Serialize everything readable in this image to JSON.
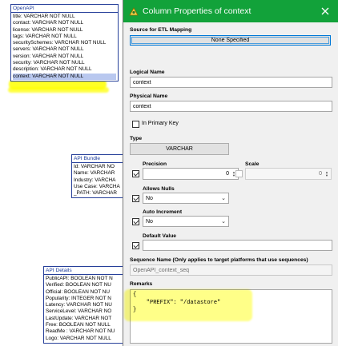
{
  "diagram": {
    "openapi": {
      "title": "OpenAPI",
      "rows": [
        "title: VARCHAR   NOT NULL",
        "contact: VARCHAR   NOT NULL",
        "license: VARCHAR   NOT NULL",
        "tags: VARCHAR   NOT NULL",
        "securitySchemes: VARCHAR   NOT NULL",
        "servers: VARCHAR   NOT NULL",
        "version: VARCHAR   NOT NULL",
        "security: VARCHAR   NOT NULL",
        "description: VARCHAR   NOT NULL",
        "context: VARCHAR   NOT NULL"
      ]
    },
    "api_bundle": {
      "title": "API Bundle",
      "rows": [
        "Id: VARCHAR   NO",
        "Name: VARCHAR",
        "Industry: VARCHA",
        "Use Case: VARCHA",
        "_PATH: VARCHAR"
      ]
    },
    "api_details": {
      "title": "API Details",
      "rows": [
        "PublicAPI: BOOLEAN   NOT N",
        "Verified: BOOLEAN   NOT NU",
        "Official: BOOLEAN   NOT NU",
        "Popularity: INTEGER   NOT N",
        "Latency: VARCHAR   NOT NU",
        "ServiceLevel: VARCHAR   NO",
        "LastUpdate: VARCHAR   NOT",
        "Free: BOOLEAN   NOT NULL",
        "ReadMe : VARCHAR   NOT NU",
        "Logo: VARCHAR   NOT NULL"
      ]
    }
  },
  "dialog": {
    "title": "Column Properties of context",
    "source_label": "Source for ETL Mapping",
    "source_value": "None Specified",
    "logical_name_label": "Logical Name",
    "logical_name_value": "context",
    "physical_name_label": "Physical Name",
    "physical_name_value": "context",
    "in_primary_key_label": "In Primary Key",
    "in_primary_key_checked": false,
    "type_label": "Type",
    "type_value": "VARCHAR",
    "precision_label": "Precision",
    "precision_value": "0",
    "precision_checked": true,
    "scale_label": "Scale",
    "scale_value": "0",
    "scale_checked": false,
    "allows_nulls_label": "Allows Nulls",
    "allows_nulls_value": "No",
    "allows_nulls_checked": true,
    "auto_increment_label": "Auto Increment",
    "auto_increment_value": "No",
    "auto_increment_checked": true,
    "default_value_label": "Default Value",
    "default_value": "",
    "default_value_checked": true,
    "sequence_label": "Sequence Name (Only applies to target platforms that use sequences)",
    "sequence_value": "OpenAPI_context_seq",
    "remarks_label": "Remarks",
    "remarks_lines": [
      "{",
      "    \"PREFIX\": \"/datastore\"",
      "}"
    ]
  },
  "colors": {
    "titlebar": "#12a23a",
    "entity_border": "#27409a",
    "selected_row": "#b9c8ef",
    "highlight": "#ffff00"
  }
}
